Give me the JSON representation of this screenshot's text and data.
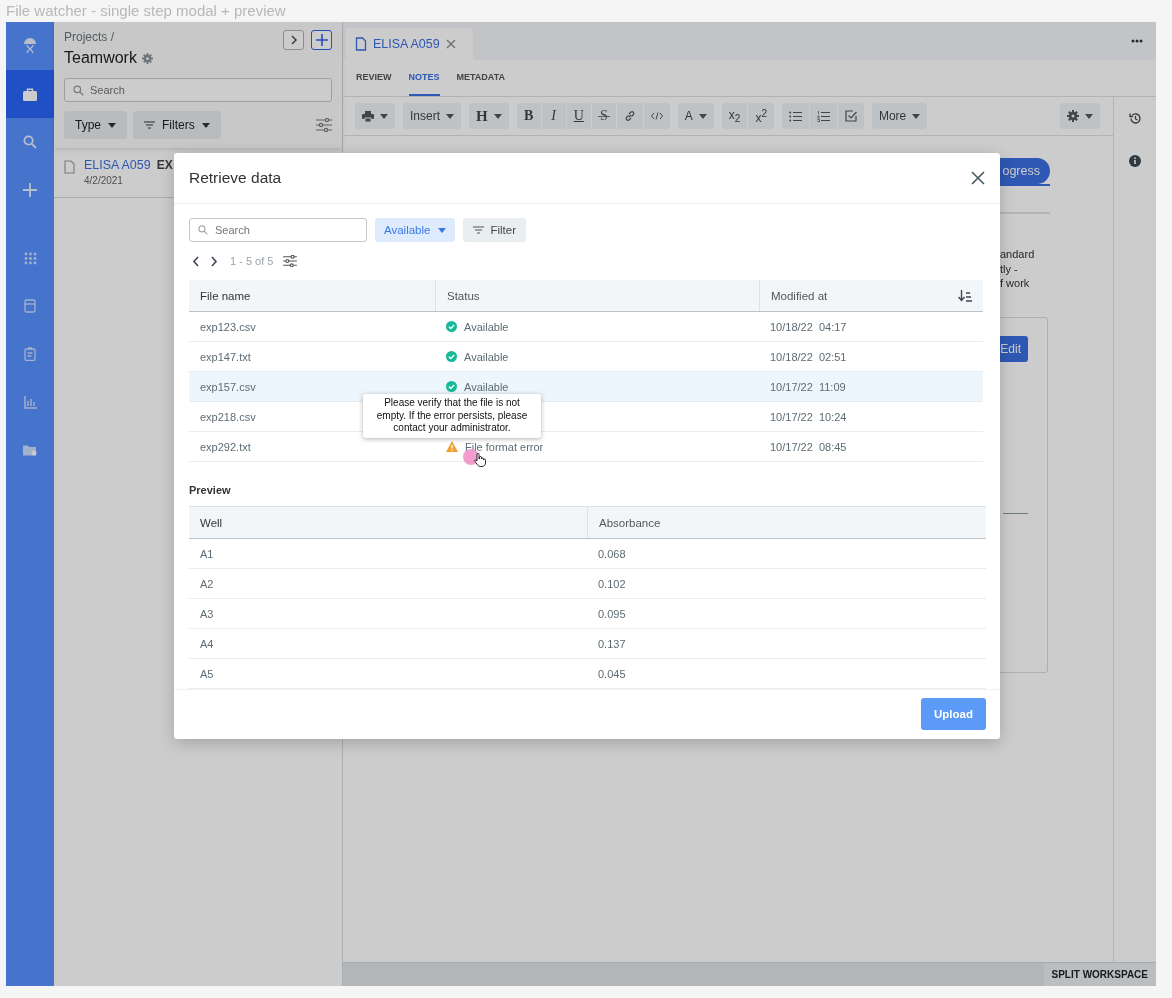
{
  "caption": "File watcher - single step modal + preview",
  "nav_rail": {
    "top_items": [
      {
        "kind": "logo",
        "selected": false
      },
      {
        "kind": "briefcase",
        "selected": true
      },
      {
        "kind": "search",
        "selected": false
      },
      {
        "kind": "add",
        "selected": false
      }
    ],
    "app_items": [
      {
        "kind": "apps",
        "selected": false
      },
      {
        "kind": "layout",
        "selected": false
      },
      {
        "kind": "clipboard",
        "selected": false
      },
      {
        "kind": "chart",
        "selected": false
      },
      {
        "kind": "folder",
        "selected": false
      }
    ]
  },
  "project_panel": {
    "breadcrumb": "Projects /",
    "title": "Teamwork",
    "search": {
      "placeholder": "Search"
    },
    "filters": [
      {
        "label": "Type",
        "kind": "plain"
      },
      {
        "label": "Filters",
        "kind": "filter"
      }
    ],
    "items": [
      {
        "title": "ELISA A059",
        "tag": "EX",
        "date": "4/2/2021"
      }
    ]
  },
  "editor": {
    "tab": {
      "title": "ELISA A059"
    },
    "subtabs": [
      {
        "label": "REVIEW",
        "selected": false
      },
      {
        "label": "NOTES",
        "selected": true
      },
      {
        "label": "METADATA",
        "selected": false
      }
    ],
    "toolbar": [
      {
        "items": [
          {
            "kind": "print",
            "dropdown": true
          }
        ]
      },
      {
        "items": [
          {
            "kind": "label",
            "label": "Insert",
            "dropdown": true
          }
        ]
      },
      {
        "items": [
          {
            "kind": "glyph",
            "label": "H",
            "dropdown": true
          }
        ]
      },
      {
        "items": [
          {
            "kind": "bold",
            "label": "B",
            "dropdown": false
          },
          {
            "kind": "italic",
            "label": "I",
            "dropdown": false
          },
          {
            "kind": "underline",
            "label": "U",
            "dropdown": false
          },
          {
            "kind": "strike",
            "label": "S",
            "dropdown": false
          },
          {
            "kind": "link",
            "dropdown": false
          },
          {
            "kind": "code",
            "dropdown": false
          }
        ]
      },
      {
        "items": [
          {
            "kind": "label",
            "label": "A",
            "dropdown": true
          }
        ]
      },
      {
        "items": [
          {
            "kind": "label",
            "label": "x$_{2}$",
            "dropdown": false
          },
          {
            "kind": "label",
            "label": "x$^{2}$",
            "dropdown": false
          }
        ]
      },
      {
        "items": [
          {
            "kind": "bullets",
            "dropdown": false
          },
          {
            "kind": "numbers",
            "dropdown": false
          },
          {
            "kind": "checklist",
            "dropdown": false
          }
        ]
      },
      {
        "items": [
          {
            "kind": "label",
            "label": "More",
            "dropdown": true
          }
        ]
      }
    ],
    "settings": {
      "dropdown": true
    },
    "status_button": "ogress",
    "note_lines": [
      "andard",
      "tly -",
      "f work"
    ],
    "edit_button": "Edit"
  },
  "bottom_bar": {
    "button": "SPLIT WORKSPACE"
  },
  "modal": {
    "title": "Retrieve data",
    "search": {
      "placeholder": "Search"
    },
    "status_filter": "Available",
    "filter_button": "Filter",
    "pagination": "1 - 5 of 5",
    "files": {
      "columns": [
        "File name",
        "Status",
        "Modified at"
      ],
      "rows": [
        {
          "name": "exp123.csv",
          "status": {
            "kind": "available",
            "label": "Available"
          },
          "modified": "10/18/22  04:17",
          "highlighted": false
        },
        {
          "name": "exp147.txt",
          "status": {
            "kind": "available",
            "label": "Available"
          },
          "modified": "10/18/22  02:51",
          "highlighted": false
        },
        {
          "name": "exp157.csv",
          "status": {
            "kind": "available",
            "label": "Available"
          },
          "modified": "10/17/22  11:09",
          "highlighted": true
        },
        {
          "name": "exp218.csv",
          "modified": "10/17/22  10:24",
          "highlighted": false
        },
        {
          "name": "exp292.txt",
          "status": {
            "kind": "error",
            "label": "File format error"
          },
          "modified": "10/17/22  08:45",
          "highlighted": false
        }
      ]
    },
    "tooltip": "Please verify that the file is not empty. If the error persists, please contact your administrator.",
    "preview": {
      "title": "Preview",
      "columns": [
        "Well",
        "Absorbance"
      ],
      "rows": [
        [
          "A1",
          "0.068"
        ],
        [
          "A2",
          "0.102"
        ],
        [
          "A3",
          "0.095"
        ],
        [
          "A4",
          "0.137"
        ],
        [
          "A5",
          "0.045"
        ]
      ]
    },
    "upload_button": "Upload"
  }
}
